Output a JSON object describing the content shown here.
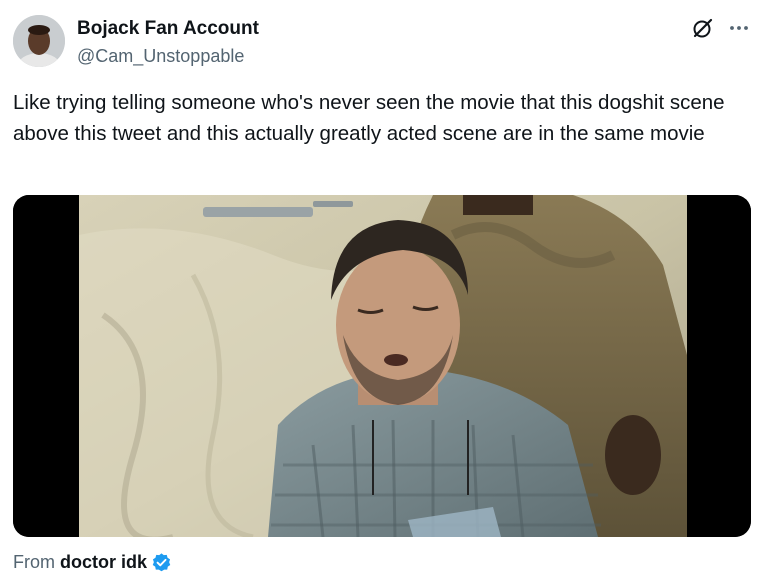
{
  "author": {
    "display_name": "Bojack Fan Account",
    "handle": "@Cam_Unstoppable",
    "avatar_icon": "avatar-photo"
  },
  "actions": {
    "grok_icon": "grok-icon",
    "more_icon": "more-icon"
  },
  "tweet": {
    "text": "Like trying telling someone who's never seen the movie that this dogshit scene above this tweet and this actually greatly acted scene are in the same movie"
  },
  "media": {
    "type": "video-still",
    "description_icon": "video-thumbnail"
  },
  "attribution": {
    "from_label": "From",
    "source_name": "doctor idk",
    "verified_icon": "verified-badge-icon",
    "verified_color": "#1d9bf0"
  },
  "colors": {
    "primary_text": "#0f1419",
    "secondary_text": "#536471",
    "accent": "#1d9bf0"
  }
}
